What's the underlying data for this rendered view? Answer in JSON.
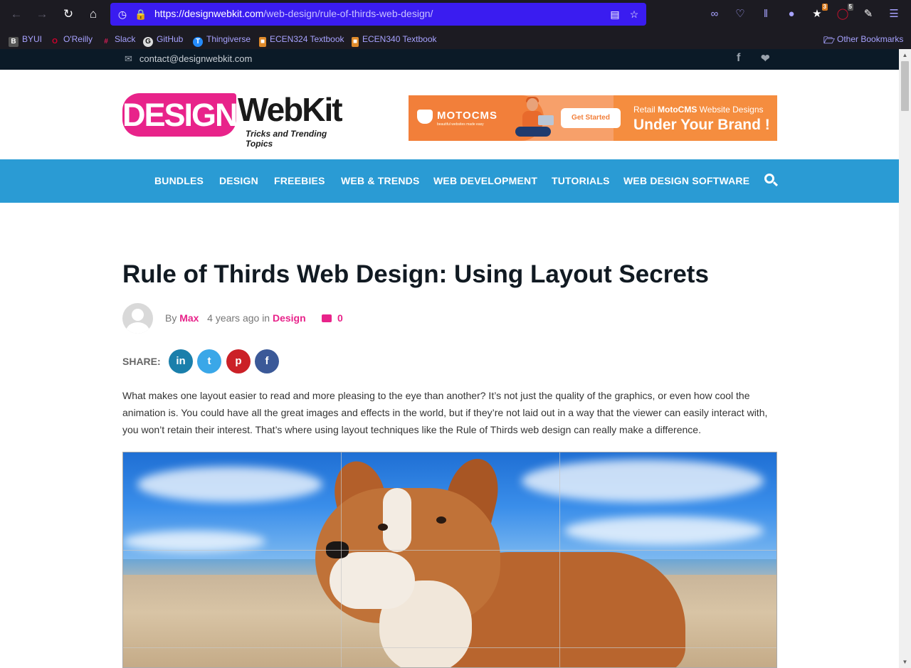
{
  "browser": {
    "url_host": "https://designwebkit.com",
    "url_path": "/web-design/rule-of-thirds-web-design/",
    "badges": {
      "ext1": "3",
      "ext2": "5"
    }
  },
  "bookmarks": [
    {
      "label": "BYUI",
      "icon": "byui-icon",
      "color": "#555555"
    },
    {
      "label": "O'Reilly",
      "icon": "oreilly-icon",
      "color": "#d3002d"
    },
    {
      "label": "Slack",
      "icon": "slack-icon",
      "color": "#611f69"
    },
    {
      "label": "GitHub",
      "icon": "github-icon",
      "color": "#333333"
    },
    {
      "label": "Thingiverse",
      "icon": "thingiverse-icon",
      "color": "#248bfb"
    },
    {
      "label": "ECEN324 Textbook",
      "icon": "book-icon",
      "color": "#e08a2a"
    },
    {
      "label": "ECEN340 Textbook",
      "icon": "book-icon",
      "color": "#e08a2a"
    }
  ],
  "other_bookmarks": "Other Bookmarks",
  "topbar": {
    "email": "contact@designwebkit.com"
  },
  "logo": {
    "part1": "DESIGN",
    "part2": "WebKit",
    "tagline": "Tricks and Trending Topics"
  },
  "ad": {
    "brand": "MOTOCMS",
    "brand_sub": "beautiful websites made easy",
    "cta": "Get Started",
    "line1_prefix": "Retail ",
    "line1_brand": "MotoCMS",
    "line1_suffix": " Website Designs",
    "line2": "Under Your Brand !"
  },
  "nav": {
    "items": [
      "BUNDLES",
      "DESIGN",
      "FREEBIES",
      "WEB & TRENDS",
      "WEB DEVELOPMENT",
      "TUTORIALS",
      "WEB DESIGN SOFTWARE"
    ]
  },
  "article": {
    "title": "Rule of Thirds Web Design: Using Layout Secrets",
    "by": "By",
    "author": "Max",
    "time": "4 years ago in",
    "category": "Design",
    "comments": "0",
    "share_label": "SHARE:",
    "intro": "What makes one layout easier to read and more pleasing to the eye than another? It’s not just the quality of the graphics, or even how cool the animation is. You could have all the great images and effects in the world, but if they’re not laid out in a way that the viewer can easily interact with, you won’t retain their interest. That’s where using layout techniques like the Rule of Thirds web design can really make a difference."
  },
  "share": [
    {
      "glyph": "in",
      "color": "#0e76a8"
    },
    {
      "glyph": "t",
      "color": "#1da1f2"
    },
    {
      "glyph": "p",
      "color": "#cb2027"
    },
    {
      "glyph": "f",
      "color": "#3b5998"
    }
  ],
  "colors": {
    "accent": "#e8238a",
    "nav": "#2a9bd4",
    "topbar": "#0b1a27",
    "url_bar": "#3a1cf0"
  }
}
